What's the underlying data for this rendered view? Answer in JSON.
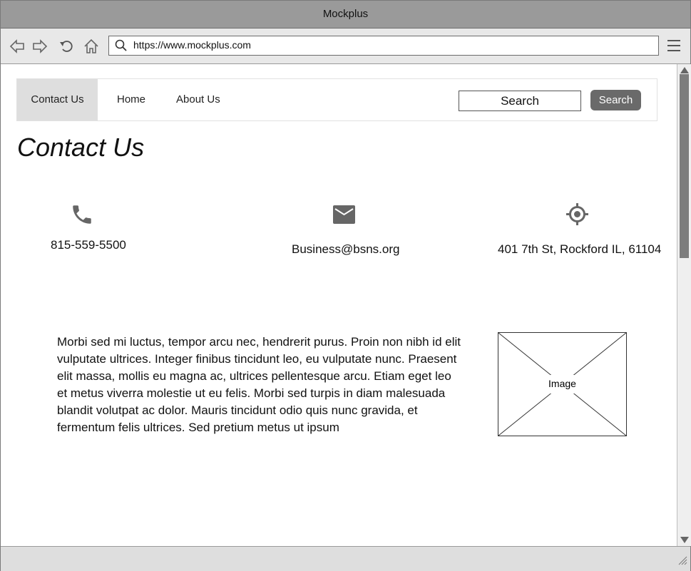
{
  "window": {
    "title": "Mockplus"
  },
  "toolbar": {
    "url": "https://www.mockplus.com",
    "icons": [
      "back-icon",
      "forward-icon",
      "refresh-icon",
      "home-icon",
      "search-icon",
      "hamburger-menu-icon"
    ]
  },
  "nav": {
    "items": [
      {
        "label": "Contact Us",
        "active": true
      },
      {
        "label": "Home",
        "active": false
      },
      {
        "label": "About Us",
        "active": false
      }
    ],
    "search_placeholder": "Search",
    "search_button": "Search"
  },
  "page": {
    "title": "Contact Us",
    "contacts": [
      {
        "icon": "phone-icon",
        "text": "815-559-5500"
      },
      {
        "icon": "mail-icon",
        "text": "Business@bsns.org"
      },
      {
        "icon": "location-icon",
        "text": "401 7th St, Rockford IL, 61104"
      }
    ],
    "paragraph": "Morbi sed mi luctus, tempor arcu nec, hendrerit purus. Proin non nibh id elit vulputate ultrices. Integer finibus tincidunt leo, eu vulputate nunc. Praesent elit massa, mollis eu magna ac, ultrices pellentesque arcu. Etiam eget leo et metus viverra molestie ut eu felis. Morbi sed turpis in diam malesuada blandit volutpat ac dolor. Mauris tincidunt odio quis nunc gravida, et fermentum felis ultrices. Sed pretium metus ut ipsum",
    "image_label": "Image"
  },
  "colors": {
    "titlebar": "#9a9a9a",
    "button": "#6a6a6a",
    "active_nav": "#dedede",
    "icon": "#666666"
  }
}
